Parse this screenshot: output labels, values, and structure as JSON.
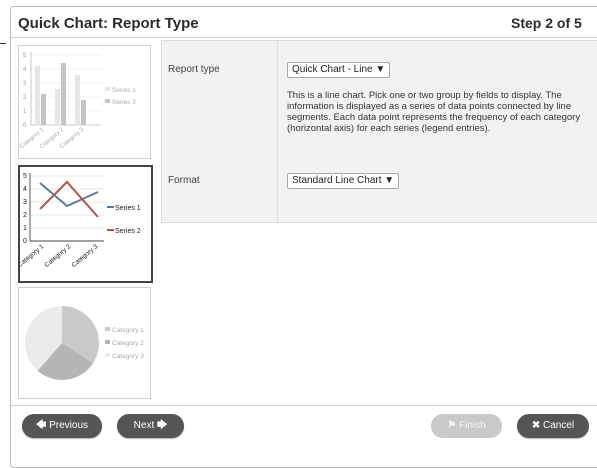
{
  "dialog": {
    "title": "Quick Chart: Report Type",
    "step": "Step 2 of 5"
  },
  "thumbnails": {
    "bar": {
      "y_ticks": [
        "5",
        "4",
        "3",
        "2",
        "1",
        "0"
      ],
      "legend": [
        "Series 1",
        "Series 2"
      ],
      "categories": [
        "Category 1",
        "Category 2",
        "Category 3"
      ]
    },
    "line": {
      "y_ticks": [
        "5",
        "4",
        "3",
        "2",
        "1",
        "0"
      ],
      "legend": [
        "Series 1",
        "Series 2"
      ],
      "categories": [
        "Category 1",
        "Category 2",
        "Category 3"
      ]
    },
    "pie": {
      "legend": [
        "Category 1",
        "Category 2",
        "Category 3"
      ]
    }
  },
  "settings": {
    "report_type_label": "Report type",
    "report_type_value": "Quick Chart - Line ▼",
    "description": "This is a line chart. Pick one or two group by fields to display. The information is displayed as a series of data points connected by line segments. Each data point represents the frequency of each category (horizontal axis) for each series (legend entries).",
    "format_label": "Format",
    "format_value": "Standard Line Chart  ▼"
  },
  "buttons": {
    "previous": "Previous",
    "next": "Next",
    "finish": "Finish",
    "cancel": "Cancel"
  }
}
